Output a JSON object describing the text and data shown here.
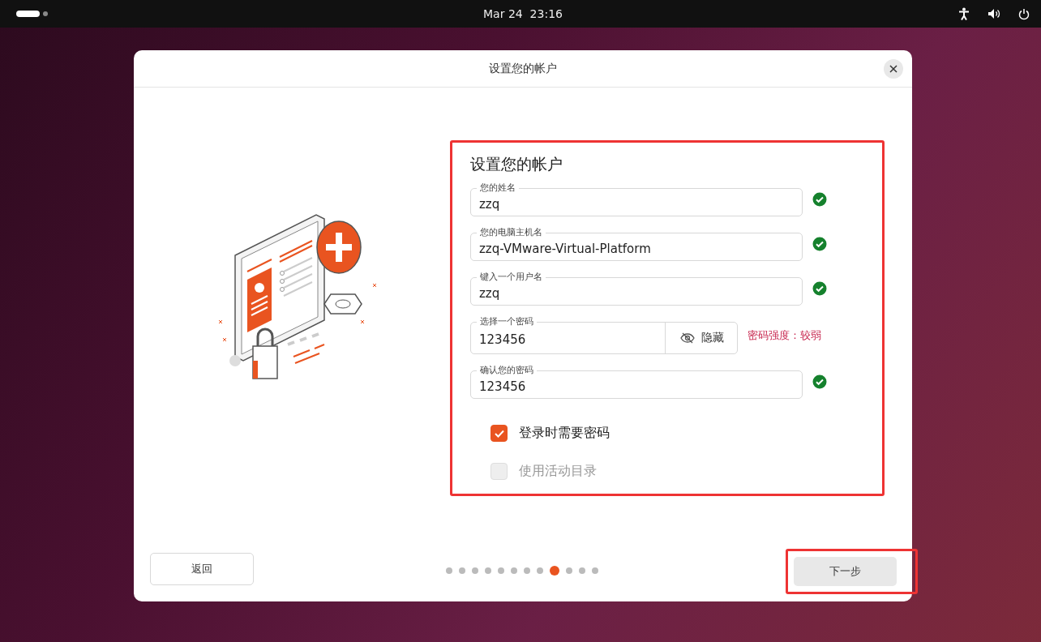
{
  "top_bar": {
    "clock": "Mar 24  23:16"
  },
  "dialog": {
    "title": "设置您的帐户"
  },
  "form": {
    "heading": "设置您的帐户",
    "fields": [
      {
        "kind": "text",
        "label": "您的姓名",
        "value": "zzq",
        "valid": true
      },
      {
        "kind": "text",
        "label": "您的电脑主机名",
        "value": "zzq-VMware-Virtual-Platform",
        "valid": true
      },
      {
        "kind": "text",
        "label": "键入一个用户名",
        "value": "zzq",
        "valid": true
      },
      {
        "kind": "password",
        "label": "选择一个密码",
        "value": "123456",
        "toggle": "隐藏",
        "strength": "密码强度：较弱"
      },
      {
        "kind": "text",
        "label": "确认您的密码",
        "value": "123456",
        "valid": true
      }
    ],
    "checkboxes": [
      {
        "label": "登录时需要密码",
        "checked": true,
        "disabled": false
      },
      {
        "label": "使用活动目录",
        "checked": false,
        "disabled": true
      }
    ]
  },
  "footer": {
    "back": "返回",
    "next": "下一步",
    "steps": [
      {
        "selected": false
      },
      {
        "selected": false
      },
      {
        "selected": false
      },
      {
        "selected": false
      },
      {
        "selected": false
      },
      {
        "selected": false
      },
      {
        "selected": false
      },
      {
        "selected": false
      },
      {
        "selected": true
      },
      {
        "selected": false
      },
      {
        "selected": false
      },
      {
        "selected": false
      }
    ]
  }
}
